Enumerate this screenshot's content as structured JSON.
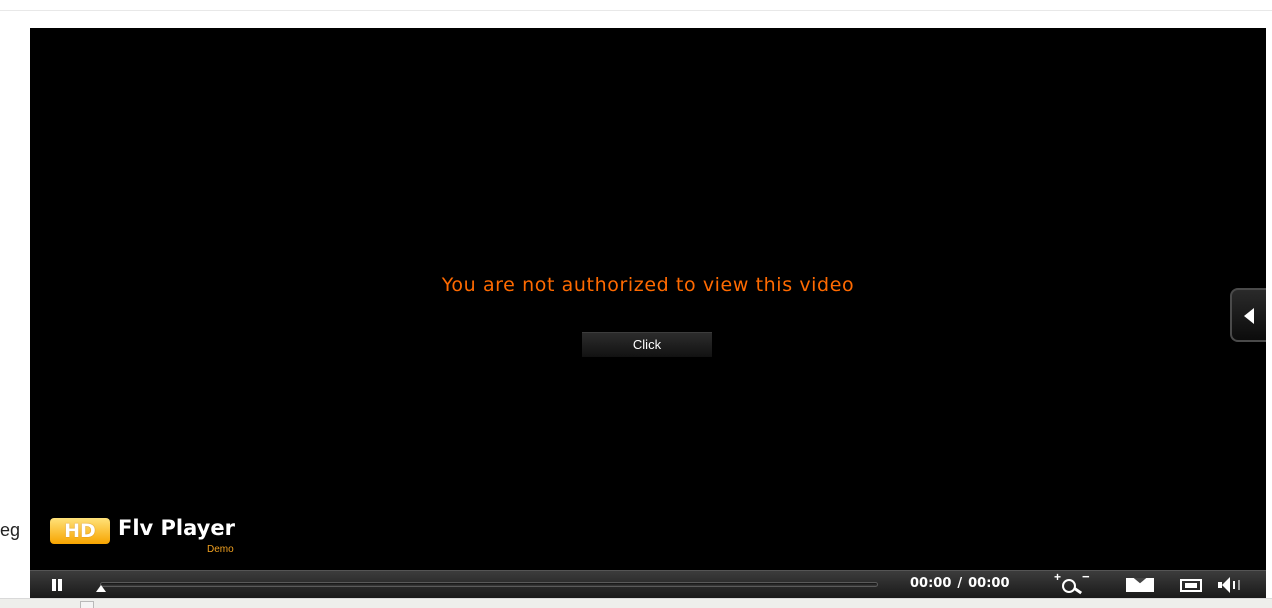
{
  "page": {
    "side_text_fragment": "eg"
  },
  "player": {
    "message": "You are not authorized to view this video",
    "message_color": "#ff6a00",
    "click_button_label": "Click",
    "logo": {
      "badge": "HD",
      "name": "Flv Player",
      "edition": "Demo"
    },
    "side_panel_icon": "chevron-left-icon",
    "controls": {
      "play_state_icon": "pause-icon",
      "current_time": "00:00",
      "time_separator": "/",
      "total_time": "00:00",
      "progress_fraction": 0,
      "icons": [
        "zoom-icon",
        "email-icon",
        "fullscreen-icon",
        "volume-icon"
      ]
    }
  }
}
